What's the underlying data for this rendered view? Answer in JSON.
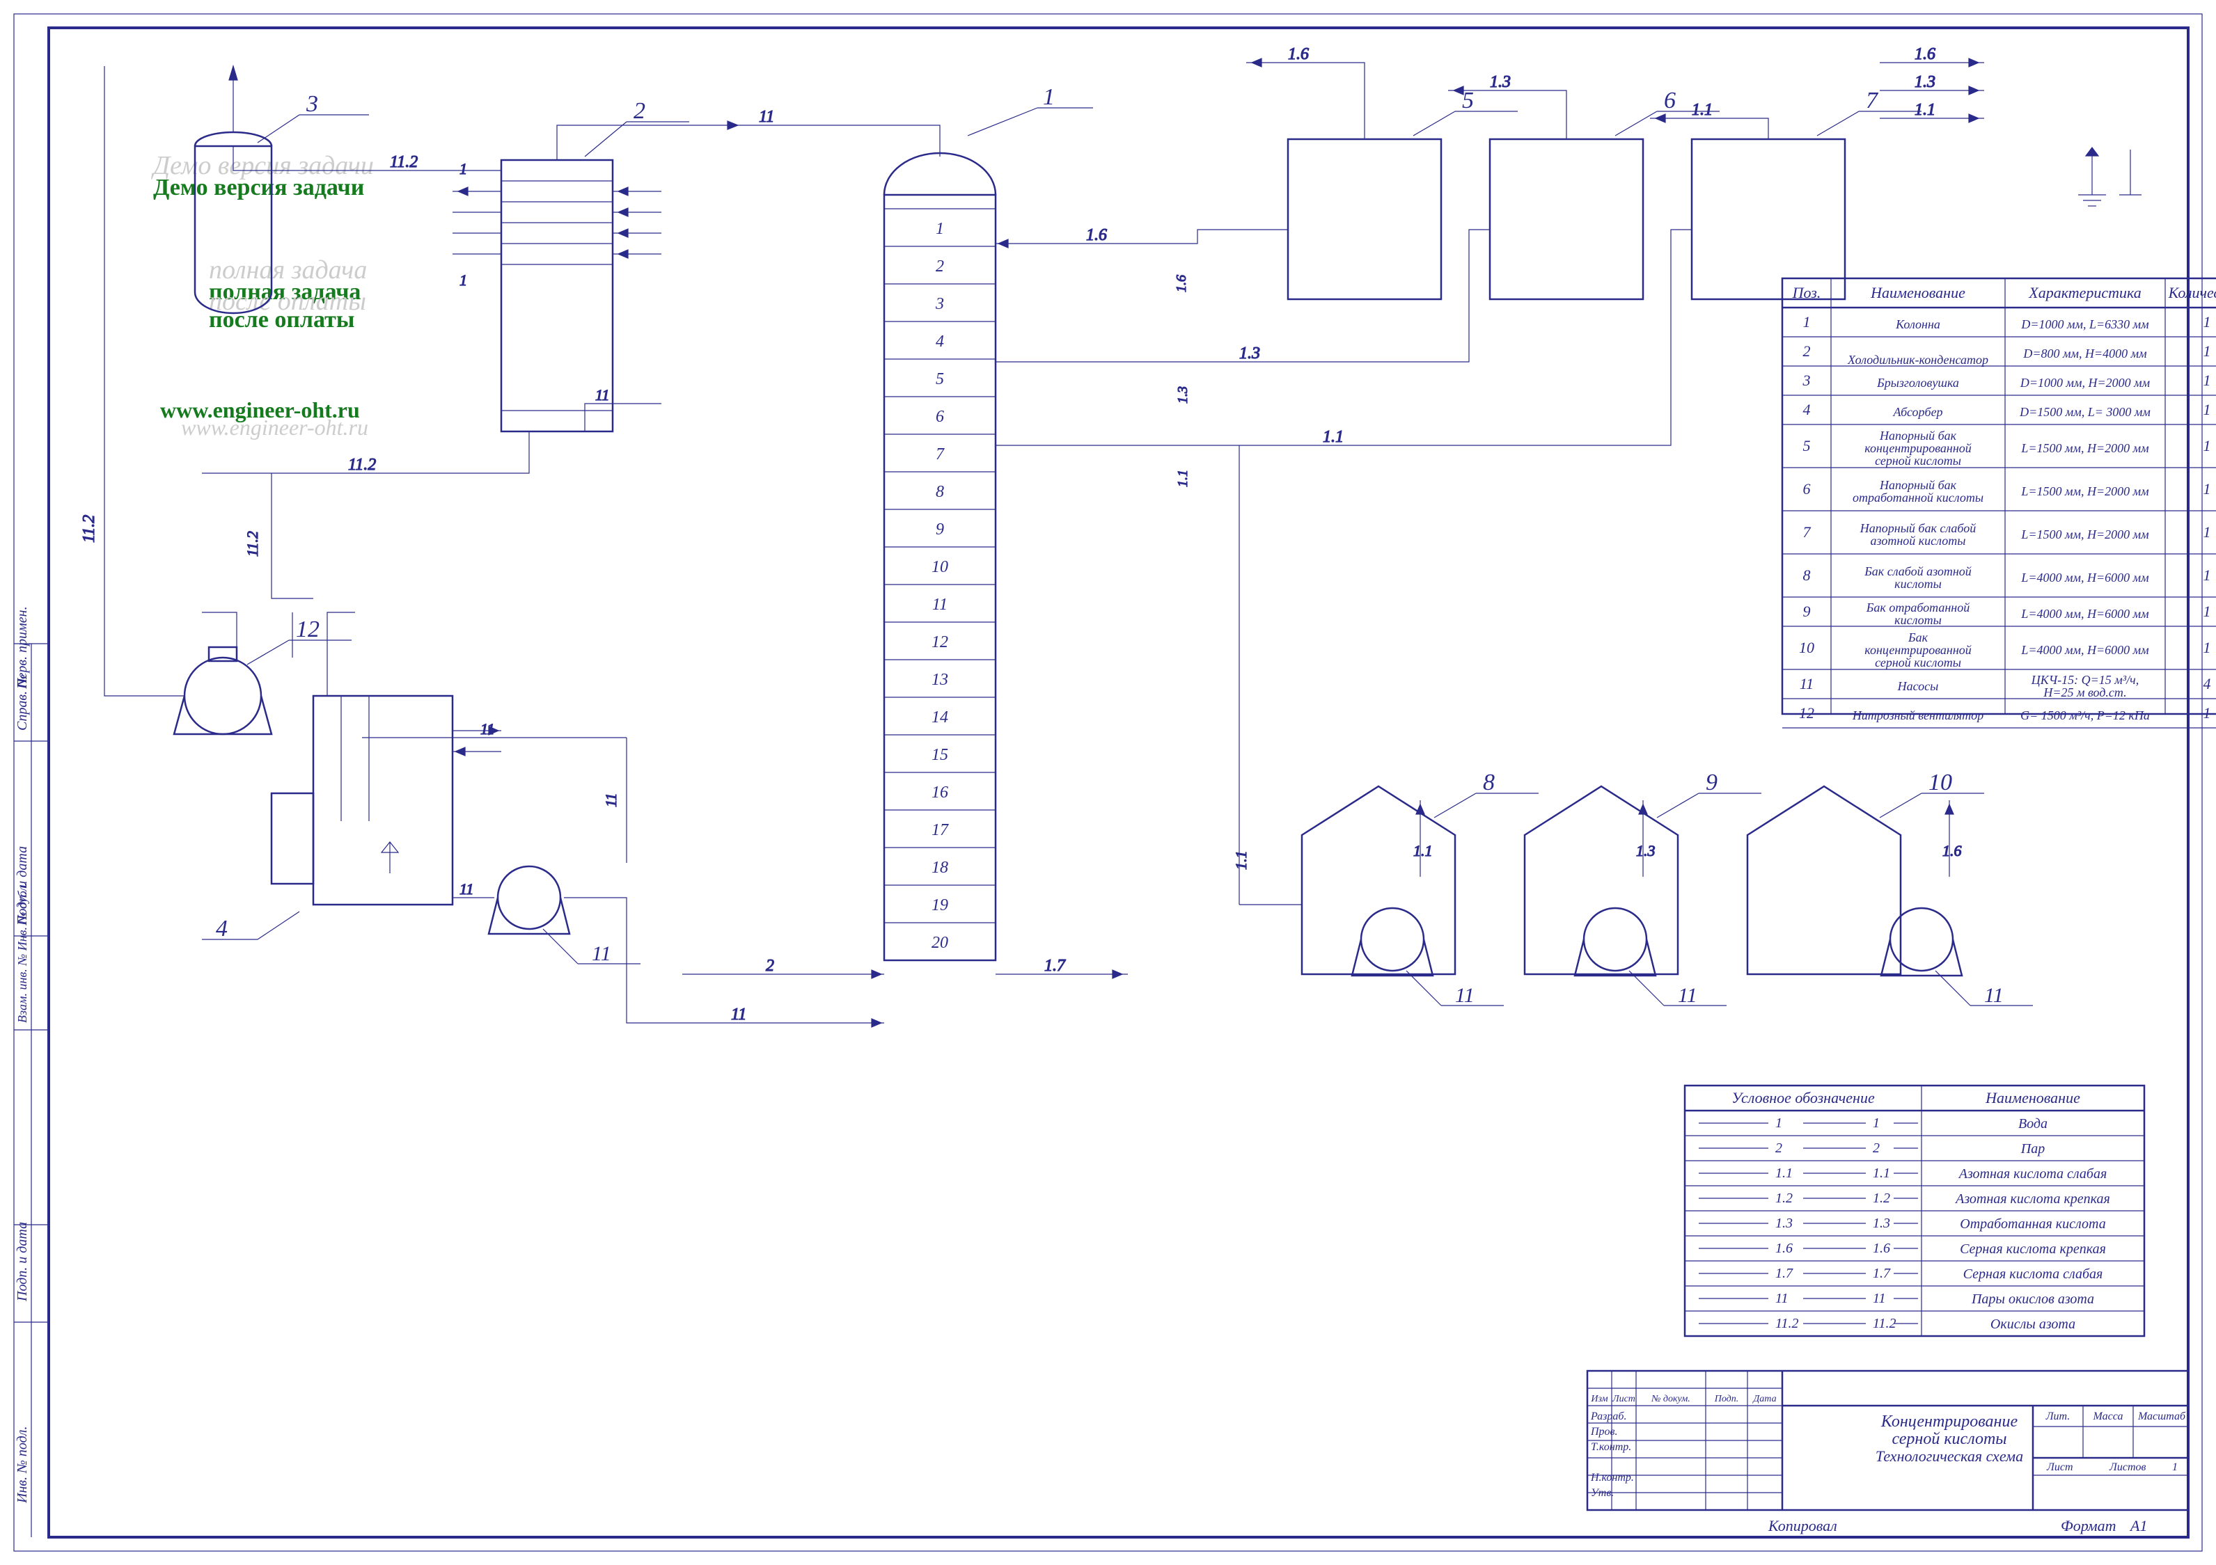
{
  "watermark": {
    "l1": "Демо версия задачи",
    "l2": "Демо версия задачи",
    "l3": "полная задача",
    "l4": "полная задача",
    "l5": "после оплаты",
    "l6": "после оплаты",
    "url1": "www.engineer-oht.ru",
    "url2": "www.engineer-oht.ru"
  },
  "column": {
    "trays": [
      "1",
      "2",
      "3",
      "4",
      "5",
      "6",
      "7",
      "8",
      "9",
      "10",
      "11",
      "12",
      "13",
      "14",
      "15",
      "16",
      "17",
      "18",
      "19",
      "20"
    ]
  },
  "equipLabels": {
    "n1": "1",
    "n2": "2",
    "n3": "3",
    "n4": "4",
    "n5": "5",
    "n6": "6",
    "n7": "7",
    "n8": "8",
    "n9": "9",
    "n10": "10",
    "n11": "11",
    "n12": "12"
  },
  "stream": {
    "s1": "1",
    "s2": "2",
    "s11": "1.1",
    "s12": "1.2",
    "s13": "1.3",
    "s16": "1.6",
    "s17": "1.7",
    "sii": "11",
    "sii2": "11.2"
  },
  "bom": {
    "headers": {
      "pos": "Поз.",
      "name": "Наименование",
      "char": "Характеристика",
      "qty": "Количество"
    },
    "rows": [
      {
        "pos": "1",
        "name": "Колонна",
        "char": "D=1000 мм, L=6330 мм",
        "qty": "1"
      },
      {
        "pos": "2",
        "name": "Холодильник-конденсатор",
        "char": "D=800 мм, H=4000 мм",
        "qty": "1"
      },
      {
        "pos": "3",
        "name": "Брызголовушка",
        "char": "D=1000 мм, H=2000 мм",
        "qty": "1"
      },
      {
        "pos": "4",
        "name": "Абсорбер",
        "char": "D=1500 мм, L= 3000 мм",
        "qty": "1"
      },
      {
        "pos": "5",
        "name": "Напорный бак концентрированной серной кислоты",
        "char": "L=1500 мм, H=2000 мм",
        "qty": "1"
      },
      {
        "pos": "6",
        "name": "Напорный бак отработанной кислоты",
        "char": "L=1500 мм, H=2000 мм",
        "qty": "1"
      },
      {
        "pos": "7",
        "name": "Напорный бак слабой азотной кислоты",
        "char": "L=1500 мм, H=2000 мм",
        "qty": "1"
      },
      {
        "pos": "8",
        "name": "Бак слабой азотной кислоты",
        "char": "L=4000 мм, H=6000 мм",
        "qty": "1"
      },
      {
        "pos": "9",
        "name": "Бак отработанной кислоты",
        "char": "L=4000 мм, H=6000 мм",
        "qty": "1"
      },
      {
        "pos": "10",
        "name": "Бак концентрированной серной кислоты",
        "char": "L=4000 мм, H=6000 мм",
        "qty": "1"
      },
      {
        "pos": "11",
        "name": "Насосы",
        "char": "ЦКЧ-15: Q=15 м³/ч, H=25 м вод.ст.",
        "qty": "4"
      },
      {
        "pos": "12",
        "name": "Нитрозный вентилятор",
        "char": "G= 1500 м³/ч, P=12 кПа",
        "qty": "1"
      }
    ]
  },
  "legend": {
    "headers": {
      "sym": "Условное обозначение",
      "name": "Наименование"
    },
    "rows": [
      {
        "sym": "1",
        "name": "Вода"
      },
      {
        "sym": "2",
        "name": "Пар"
      },
      {
        "sym": "1.1",
        "name": "Азотная кислота слабая"
      },
      {
        "sym": "1.2",
        "name": "Азотная кислота крепкая"
      },
      {
        "sym": "1.3",
        "name": "Отработанная кислота"
      },
      {
        "sym": "1.6",
        "name": "Серная кислота крепкая"
      },
      {
        "sym": "1.7",
        "name": "Серная кислота слабая"
      },
      {
        "sym": "11",
        "name": "Пары окислов азота"
      },
      {
        "sym": "11.2",
        "name": "Окислы азота"
      }
    ]
  },
  "titleblock": {
    "title1": "Концентрирование",
    "title2": "серной кислоты",
    "title3": "Технологическая схема",
    "rowLabels": [
      "Изм",
      "Лист",
      "№ докум.",
      "Подп.",
      "Дата"
    ],
    "leftRows": [
      "Разраб.",
      "Пров.",
      "Т.контр.",
      "",
      "Н.контр.",
      "Утв."
    ],
    "lit": "Лит.",
    "mass": "Масса",
    "scale": "Масштаб",
    "sheet": "Лист",
    "sheets": "Листов",
    "sheetsN": "1",
    "format": "Формат",
    "formatN": "А1",
    "copy": "Копировал"
  },
  "side": {
    "a": "Инв. № подл.",
    "b": "Подп. и дата",
    "c": "Взам. инв. № Инв. № дубл.",
    "d": "Подп. и дата",
    "e": "Справ. №",
    "f": "Перв. примен."
  }
}
